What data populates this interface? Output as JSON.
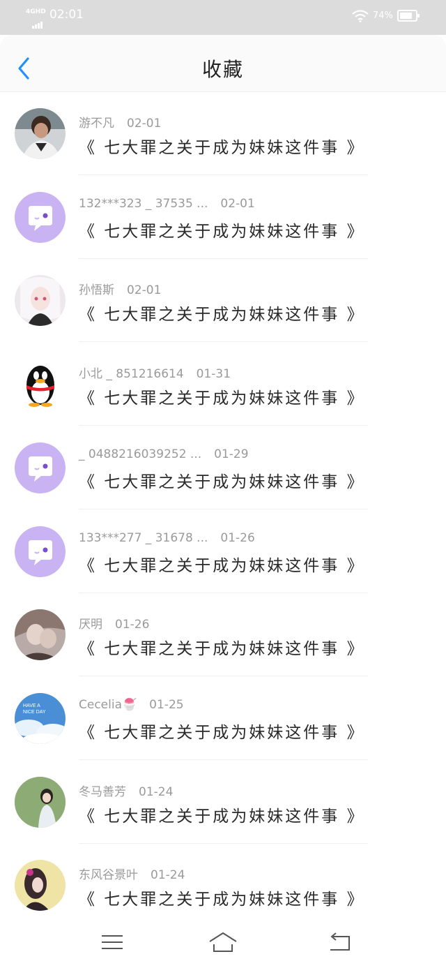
{
  "status_bar": {
    "network": "4GHD",
    "time": "02:01",
    "battery": "74%"
  },
  "header": {
    "back_icon": "chevron-left-icon",
    "title": "收藏"
  },
  "items": [
    {
      "user": "游不凡",
      "date": "02-01",
      "title": "《 七大罪之关于成为妹妹这件事 》",
      "avatar": "photo-avatar"
    },
    {
      "user": "132***323 _ 37535 ...",
      "date": "02-01",
      "title": "《 七大罪之关于成为妹妹这件事 》",
      "avatar": "chat-bubble-avatar"
    },
    {
      "user": "孙悟斯",
      "date": "02-01",
      "title": "《 七大罪之关于成为妹妹这件事 》",
      "avatar": "photo-avatar"
    },
    {
      "user": "小北 _ 851216614",
      "date": "01-31",
      "title": "《 七大罪之关于成为妹妹这件事 》",
      "avatar": "penguin-avatar"
    },
    {
      "user": "_ 0488216039252 ...",
      "date": "01-29",
      "title": "《 七大罪之关于成为妹妹这件事 》",
      "avatar": "chat-bubble-avatar"
    },
    {
      "user": "133***277 _ 31678 ...",
      "date": "01-26",
      "title": "《 七大罪之关于成为妹妹这件事 》",
      "avatar": "chat-bubble-avatar"
    },
    {
      "user": "厌明",
      "date": "01-26",
      "title": "《 七大罪之关于成为妹妹这件事 》",
      "avatar": "photo-avatar"
    },
    {
      "user": "Cecelia🍧",
      "date": "01-25",
      "title": "《 七大罪之关于成为妹妹这件事 》",
      "avatar": "photo-avatar"
    },
    {
      "user": "冬马善芳",
      "date": "01-24",
      "title": "《 七大罪之关于成为妹妹这件事 》",
      "avatar": "photo-avatar"
    },
    {
      "user": "东风谷景叶",
      "date": "01-24",
      "title": "《 七大罪之关于成为妹妹这件事 》",
      "avatar": "photo-avatar"
    }
  ],
  "bottom_nav": {
    "menu_icon": "menu-icon",
    "home_icon": "home-icon",
    "back_icon": "return-icon"
  },
  "colors": {
    "accent": "#1e90ff",
    "chat_avatar_bg": "#c9b3f2",
    "meta_text": "#9a9a9a"
  }
}
